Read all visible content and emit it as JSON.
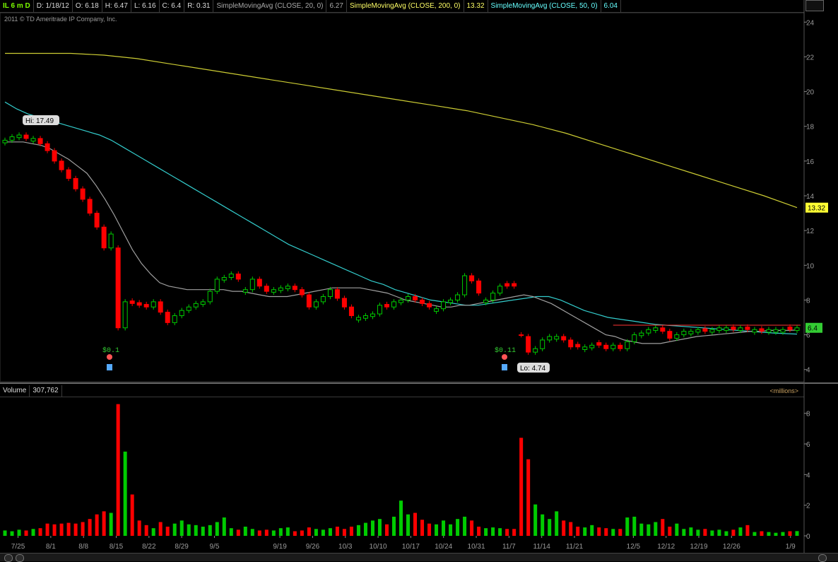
{
  "header": {
    "symbol": "IL 6 m D",
    "date": "D: 1/18/12",
    "open": "O: 6.18",
    "high": "H: 6.47",
    "low": "L: 6.16",
    "close": "C: 6.4",
    "range": "R: 0.31",
    "sma20_label": "SimpleMovingAvg (CLOSE, 20, 0)",
    "sma20_value": "6.27",
    "sma200_label": "SimpleMovingAvg (CLOSE, 200, 0)",
    "sma200_value": "13.32",
    "sma50_label": "SimpleMovingAvg (CLOSE, 50, 0)",
    "sma50_value": "6.04"
  },
  "copyright": "2011 © TD Ameritrade IP Company, Inc.",
  "volume_header": {
    "label": "Volume",
    "value": "307,762",
    "units": "<millions>"
  },
  "colors": {
    "up": "#00cc00",
    "down": "#ff0000",
    "sma20": "#a0a0a0",
    "sma50": "#33cccc",
    "sma200": "#cccc33"
  },
  "chart_data": [
    {
      "type": "candlestick",
      "ylim": [
        3.5,
        24.5
      ],
      "y_ticks": [
        4,
        6,
        8,
        10,
        12,
        14,
        16,
        18,
        20,
        22,
        24
      ],
      "annotations": {
        "high": "Hi: 17.49",
        "low": "Lo: 4.74",
        "earnings1": "$0.1",
        "earnings2": "$0.11",
        "sma200_tag": "13.32",
        "last_tag": "6.4"
      },
      "close": [
        17.2,
        17.4,
        17.5,
        17.3,
        17.3,
        17.0,
        16.6,
        16.0,
        15.5,
        15.0,
        14.4,
        13.8,
        13.0,
        12.2,
        11.0,
        11.8,
        6.4,
        7.9,
        7.8,
        7.7,
        7.6,
        7.9,
        7.3,
        6.7,
        7.1,
        7.4,
        7.6,
        7.8,
        7.9,
        8.5,
        9.2,
        9.3,
        9.5,
        9.2,
        8.6,
        9.2,
        8.8,
        8.5,
        8.6,
        8.7,
        8.8,
        8.6,
        8.3,
        7.6,
        7.9,
        8.2,
        8.6,
        8.1,
        7.6,
        7.1,
        7.0,
        7.1,
        7.2,
        7.7,
        7.6,
        7.9,
        8.0,
        8.2,
        8.0,
        7.8,
        7.6,
        7.5,
        7.9,
        8.0,
        8.3,
        9.4,
        9.1,
        8.4,
        8.0,
        8.4,
        8.8,
        8.8,
        8.8,
        6.0,
        5.0,
        5.2,
        5.7,
        5.9,
        5.9,
        5.7,
        5.3,
        5.3,
        5.3,
        5.4,
        5.4,
        5.2,
        5.4,
        5.2,
        5.6,
        6.0,
        6.1,
        6.3,
        6.4,
        6.2,
        5.8,
        6.0,
        6.2,
        6.2,
        6.3,
        6.2,
        6.3,
        6.4,
        6.4,
        6.3,
        6.4,
        6.3,
        6.3,
        6.2,
        6.3,
        6.3,
        6.3,
        6.3,
        6.4
      ],
      "up": [
        1,
        1,
        1,
        0,
        1,
        0,
        0,
        0,
        0,
        0,
        0,
        0,
        0,
        0,
        0,
        1,
        0,
        1,
        0,
        0,
        0,
        1,
        0,
        0,
        1,
        1,
        1,
        1,
        1,
        1,
        1,
        1,
        1,
        0,
        1,
        1,
        0,
        0,
        1,
        1,
        1,
        0,
        0,
        0,
        1,
        1,
        1,
        0,
        0,
        0,
        1,
        1,
        1,
        1,
        0,
        1,
        1,
        1,
        0,
        0,
        0,
        1,
        1,
        1,
        1,
        1,
        0,
        0,
        1,
        1,
        1,
        0,
        0,
        0,
        0,
        1,
        1,
        1,
        1,
        0,
        0,
        0,
        1,
        1,
        0,
        0,
        1,
        0,
        1,
        1,
        1,
        1,
        1,
        0,
        0,
        1,
        1,
        1,
        1,
        0,
        1,
        1,
        1,
        0,
        1,
        0,
        1,
        0,
        1,
        1,
        1,
        0,
        1
      ],
      "volume": [
        0.35,
        0.3,
        0.4,
        0.35,
        0.45,
        0.5,
        0.8,
        0.75,
        0.8,
        0.85,
        0.8,
        0.9,
        1.1,
        1.4,
        1.6,
        1.5,
        8.6,
        5.5,
        2.7,
        1.0,
        0.7,
        0.5,
        0.9,
        0.6,
        0.8,
        1.0,
        0.75,
        0.7,
        0.6,
        0.7,
        0.9,
        1.2,
        0.5,
        0.4,
        0.6,
        0.45,
        0.35,
        0.4,
        0.35,
        0.5,
        0.55,
        0.3,
        0.35,
        0.55,
        0.45,
        0.4,
        0.5,
        0.6,
        0.45,
        0.6,
        0.7,
        0.85,
        1.0,
        1.1,
        0.75,
        1.25,
        2.3,
        1.4,
        1.5,
        1.05,
        0.8,
        0.75,
        1.0,
        0.75,
        1.1,
        1.25,
        1.0,
        0.6,
        0.5,
        0.55,
        0.5,
        0.45,
        0.45,
        6.4,
        5.0,
        2.05,
        1.4,
        1.1,
        1.6,
        1.0,
        0.9,
        0.6,
        0.55,
        0.7,
        0.55,
        0.5,
        0.45,
        0.45,
        1.2,
        1.25,
        0.8,
        0.75,
        0.9,
        1.1,
        0.6,
        0.8,
        0.45,
        0.55,
        0.4,
        0.45,
        0.35,
        0.4,
        0.3,
        0.4,
        0.55,
        0.7,
        0.25,
        0.3,
        0.25,
        0.2,
        0.25,
        0.3,
        0.31
      ],
      "volume_ylim": [
        0,
        9
      ],
      "volume_ticks": [
        0,
        2,
        4,
        6,
        8
      ],
      "sma20": [
        17.1,
        17.1,
        17.1,
        17.0,
        16.9,
        16.7,
        16.4,
        16.1,
        15.7,
        15.3,
        14.6,
        13.8,
        12.9,
        11.9,
        10.9,
        10.1,
        9.5,
        9.0,
        8.8,
        8.7,
        8.6,
        8.6,
        8.6,
        8.6,
        8.6,
        8.5,
        8.5,
        8.4,
        8.3,
        8.2,
        8.2,
        8.2,
        8.3,
        8.4,
        8.5,
        8.6,
        8.7,
        8.7,
        8.7,
        8.7,
        8.6,
        8.5,
        8.4,
        8.2,
        8.0,
        7.9,
        7.8,
        7.7,
        7.6,
        7.6,
        7.7,
        7.7,
        7.8,
        7.9,
        8.0,
        8.1,
        8.2,
        8.3,
        8.2,
        8.0,
        7.8,
        7.5,
        7.2,
        6.9,
        6.6,
        6.3,
        6.0,
        5.9,
        5.7,
        5.6,
        5.5,
        5.5,
        5.5,
        5.6,
        5.7,
        5.8,
        5.9,
        5.95,
        6.0,
        6.05,
        6.1,
        6.15,
        6.2,
        6.2,
        6.25,
        6.25,
        6.25,
        6.27
      ],
      "sma20_start": 0,
      "sma50": [
        19.4,
        19.0,
        18.7,
        18.5,
        18.3,
        18.1,
        17.9,
        17.7,
        17.5,
        17.2,
        16.8,
        16.4,
        16.0,
        15.6,
        15.2,
        14.8,
        14.4,
        14.0,
        13.6,
        13.2,
        12.8,
        12.4,
        12.0,
        11.6,
        11.2,
        10.9,
        10.6,
        10.3,
        10.0,
        9.7,
        9.4,
        9.1,
        8.9,
        8.6,
        8.4,
        8.2,
        8.0,
        7.9,
        7.8,
        7.7,
        7.7,
        7.8,
        7.9,
        8.0,
        8.1,
        8.2,
        8.2,
        8.0,
        7.7,
        7.4,
        7.2,
        7.0,
        6.9,
        6.8,
        6.7,
        6.6,
        6.55,
        6.5,
        6.45,
        6.4,
        6.35,
        6.3,
        6.25,
        6.2,
        6.15,
        6.1,
        6.07,
        6.04
      ],
      "sma200": [
        22.2,
        22.2,
        22.2,
        22.1,
        21.9,
        21.6,
        21.3,
        21.0,
        20.7,
        20.4,
        20.1,
        19.8,
        19.5,
        19.2,
        18.9,
        18.5,
        18.1,
        17.6,
        17.0,
        16.4,
        15.8,
        15.2,
        14.6,
        14.0,
        13.32
      ]
    }
  ],
  "x_axis": {
    "price_labels": [
      "7/25",
      "8/1",
      "8/8",
      "8/15",
      "8/22",
      "8/29",
      "9/5",
      "9/19",
      "9/26",
      "10/3",
      "10/10",
      "10/17",
      "10/24",
      "10/31",
      "11/7",
      "11/14",
      "11/21",
      "12/5",
      "12/12",
      "12/19",
      "12/26",
      "1/9"
    ]
  }
}
